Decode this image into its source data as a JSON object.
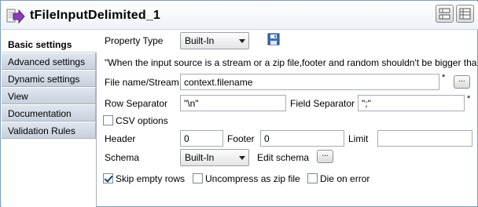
{
  "title": "tFileInputDelimited_1",
  "tabs": [
    {
      "label": "Basic settings",
      "active": true
    },
    {
      "label": "Advanced settings",
      "active": false
    },
    {
      "label": "Dynamic settings",
      "active": false
    },
    {
      "label": "View",
      "active": false
    },
    {
      "label": "Documentation",
      "active": false
    },
    {
      "label": "Validation Rules",
      "active": false
    }
  ],
  "form": {
    "property_type_label": "Property Type",
    "property_type_value": "Built-In",
    "warning": "\"When the input source is a stream or a zip file,footer and random shouldn't be bigger tha",
    "file_name_label": "File name/Stream",
    "file_name_value": "context.filename",
    "required_mark": "*",
    "browse_label": "...",
    "row_separator_label": "Row Separator",
    "row_separator_value": "\"\\n\"",
    "field_separator_label": "Field Separator",
    "field_separator_value": "\";\"",
    "csv_options_label": "CSV options",
    "csv_options_checked": false,
    "header_label": "Header",
    "header_value": "0",
    "footer_label": "Footer",
    "footer_value": "0",
    "limit_label": "Limit",
    "limit_value": "",
    "schema_label": "Schema",
    "schema_value": "Built-In",
    "edit_schema_label": "Edit schema",
    "edit_schema_btn": "...",
    "skip_empty_rows_label": "Skip empty rows",
    "skip_empty_rows_checked": true,
    "uncompress_zip_label": "Uncompress as zip file",
    "uncompress_zip_checked": false,
    "die_on_error_label": "Die on error",
    "die_on_error_checked": false
  },
  "icons": {
    "component": "file-input-delimited-icon",
    "save": "save-icon",
    "view1": "layout-grid-icon",
    "view2": "layout-list-icon"
  }
}
